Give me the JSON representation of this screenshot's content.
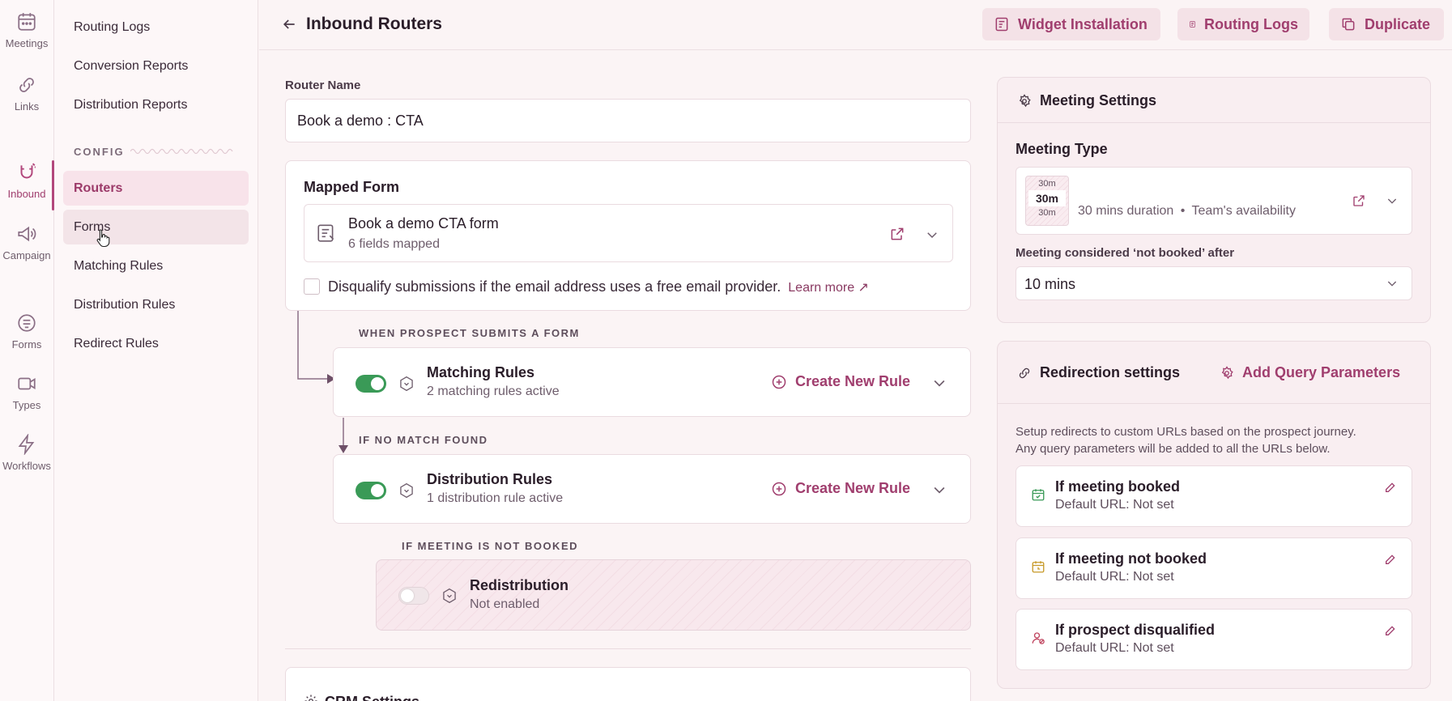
{
  "rail": {
    "items": [
      {
        "label": "Meetings",
        "icon": "calendar-icon"
      },
      {
        "label": "Links",
        "icon": "link-icon"
      },
      {
        "label": "Inbound",
        "icon": "magnet-icon",
        "active": true
      },
      {
        "label": "Campaign",
        "icon": "megaphone-icon"
      },
      {
        "label": "Forms",
        "icon": "form-icon"
      },
      {
        "label": "Types",
        "icon": "video-icon"
      },
      {
        "label": "Workflows",
        "icon": "bolt-icon"
      }
    ]
  },
  "sidebar": {
    "links_top": [
      "Routing Logs",
      "Conversion Reports",
      "Distribution Reports"
    ],
    "config_label": "CONFIG",
    "config_items": [
      "Routers",
      "Forms",
      "Matching Rules",
      "Distribution Rules",
      "Redirect Rules"
    ]
  },
  "header": {
    "title": "Inbound Routers",
    "buttons": [
      "Widget Installation",
      "Routing Logs",
      "Duplicate"
    ]
  },
  "router": {
    "name_label": "Router Name",
    "name_value": "Book a demo : CTA"
  },
  "mapped_form": {
    "title": "Mapped Form",
    "form_name": "Book a demo CTA form",
    "fields": "6 fields mapped",
    "disqualify_text": "Disqualify submissions if the email address uses a free email provider.",
    "learn_more": "Learn more ↗"
  },
  "flow": {
    "caption1": "WHEN PROSPECT SUBMITS A FORM",
    "matching": {
      "title": "Matching Rules",
      "sub": "2 matching rules active",
      "create": "Create New Rule"
    },
    "caption2": "IF NO MATCH FOUND",
    "distribution": {
      "title": "Distribution Rules",
      "sub": "1 distribution rule active",
      "create": "Create New Rule"
    },
    "caption3": "IF MEETING IS NOT BOOKED",
    "redistribution": {
      "title": "Redistribution",
      "sub": "Not enabled"
    },
    "crm_partial": "CRM Settings"
  },
  "meeting_settings": {
    "title": "Meeting Settings",
    "type_label": "Meeting Type",
    "duration_top": "30m",
    "duration_mid": "30m",
    "duration_bot": "30m",
    "duration_text": "30 mins duration",
    "availability": "Team's availability",
    "not_booked_label": "Meeting considered ‘not booked’ after",
    "not_booked_value": "10 mins"
  },
  "redirection": {
    "title": "Redirection settings",
    "add_params": "Add Query Parameters",
    "desc1": "Setup redirects to custom URLs based on the prospect journey.",
    "desc2": "Any query parameters will be added to all the URLs below.",
    "cards": [
      {
        "title": "If meeting booked",
        "sub": "Default URL:  Not set"
      },
      {
        "title": "If meeting not booked",
        "sub": "Default URL:  Not set"
      },
      {
        "title": "If prospect disqualified",
        "sub": "Default URL:  Not set"
      }
    ]
  },
  "colors": {
    "accent": "#a03e6e",
    "toggle_on": "#3a9a57",
    "background": "#fbf4f5"
  }
}
